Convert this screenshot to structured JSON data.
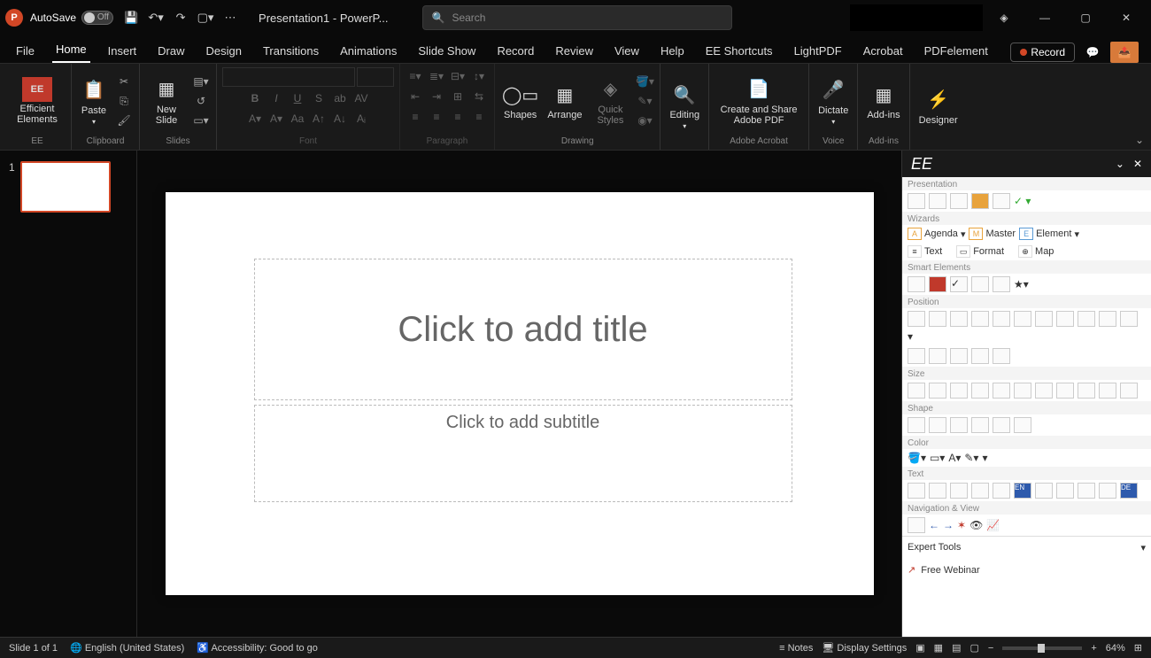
{
  "titlebar": {
    "autosave_label": "AutoSave",
    "autosave_state": "Off",
    "doc_title": "Presentation1 - PowerP...",
    "search_placeholder": "Search"
  },
  "tabs": {
    "items": [
      "File",
      "Home",
      "Insert",
      "Draw",
      "Design",
      "Transitions",
      "Animations",
      "Slide Show",
      "Record",
      "Review",
      "View",
      "Help",
      "EE Shortcuts",
      "LightPDF",
      "Acrobat",
      "PDFelement"
    ],
    "active": "Home",
    "record_label": "Record"
  },
  "ribbon": {
    "ee": {
      "label": "EE",
      "btn": "Efficient Elements"
    },
    "clipboard": {
      "label": "Clipboard",
      "paste": "Paste"
    },
    "slides": {
      "label": "Slides",
      "new_slide": "New Slide"
    },
    "font": {
      "label": "Font"
    },
    "paragraph": {
      "label": "Paragraph"
    },
    "drawing": {
      "label": "Drawing",
      "shapes": "Shapes",
      "arrange": "Arrange",
      "quick": "Quick Styles"
    },
    "editing": {
      "label": "Editing",
      "btn": "Editing"
    },
    "adobe": {
      "label": "Adobe Acrobat",
      "btn": "Create and Share Adobe PDF"
    },
    "voice": {
      "label": "Voice",
      "btn": "Dictate"
    },
    "addins": {
      "label": "Add-ins",
      "btn": "Add-ins"
    },
    "designer": {
      "btn": "Designer"
    }
  },
  "thumbs": {
    "slide1_num": "1"
  },
  "slide": {
    "title_placeholder": "Click to add title",
    "subtitle_placeholder": "Click to add subtitle"
  },
  "ee_pane": {
    "title": "EE",
    "sections": {
      "presentation": "Presentation",
      "wizards": "Wizards",
      "smart": "Smart Elements",
      "position": "Position",
      "size": "Size",
      "shape": "Shape",
      "color": "Color",
      "text": "Text",
      "nav": "Navigation & View"
    },
    "wizards": {
      "agenda": "Agenda",
      "master": "Master",
      "element": "Element",
      "text": "Text",
      "format": "Format",
      "map": "Map"
    },
    "expert": "Expert Tools",
    "webinar": "Free Webinar"
  },
  "status": {
    "slide": "Slide 1 of 1",
    "lang": "English (United States)",
    "access": "Accessibility: Good to go",
    "notes": "Notes",
    "display": "Display Settings",
    "zoom": "64%"
  }
}
